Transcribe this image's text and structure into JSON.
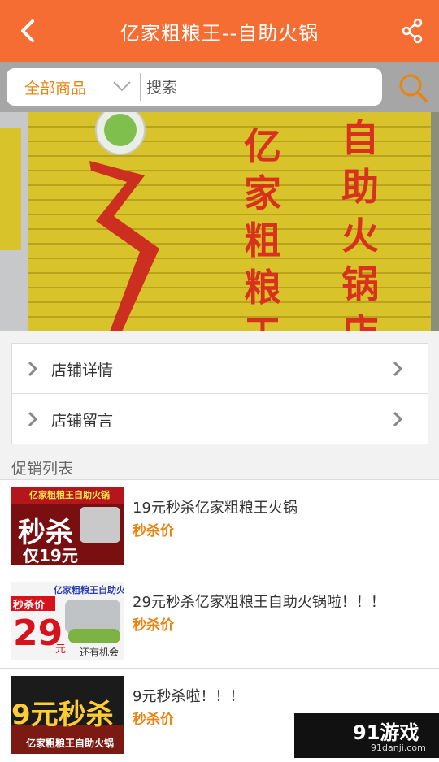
{
  "header": {
    "title": "亿家粗粮王--自助火锅"
  },
  "search": {
    "category": "全部商品",
    "placeholder": "搜索"
  },
  "banner": {
    "left_column": [
      "亿",
      "家",
      "粗",
      "粮",
      "王"
    ],
    "right_column": [
      "自",
      "助",
      "火",
      "锅",
      "店"
    ]
  },
  "menu": [
    {
      "label": "店铺详情"
    },
    {
      "label": "店铺留言"
    }
  ],
  "promo_section": {
    "title": "促销列表"
  },
  "promos": [
    {
      "title": "19元秒杀亿家粗粮王火锅",
      "price_label": "秒杀价",
      "thumb": {
        "header": "亿家粗粮王自助火锅",
        "big": "秒杀",
        "small": "仅19元"
      }
    },
    {
      "title": "29元秒杀亿家粗粮王自助火锅啦！！！",
      "price_label": "秒杀价",
      "thumb": {
        "header": "亿家粗粮王自助火锅",
        "tag": "秒杀价",
        "big": "29",
        "unit": "元",
        "note": "还有机会"
      }
    },
    {
      "title": "9元秒杀啦！！！",
      "price_label": "秒杀价",
      "thumb": {
        "big": "9元秒杀",
        "footer": "亿家粗粮王自助火锅"
      }
    }
  ],
  "watermark": {
    "brand": "91游戏",
    "site": "91danji.com"
  },
  "colors": {
    "accent": "#f56d32",
    "price": "#e8840f",
    "banner_red": "#d8321f"
  }
}
